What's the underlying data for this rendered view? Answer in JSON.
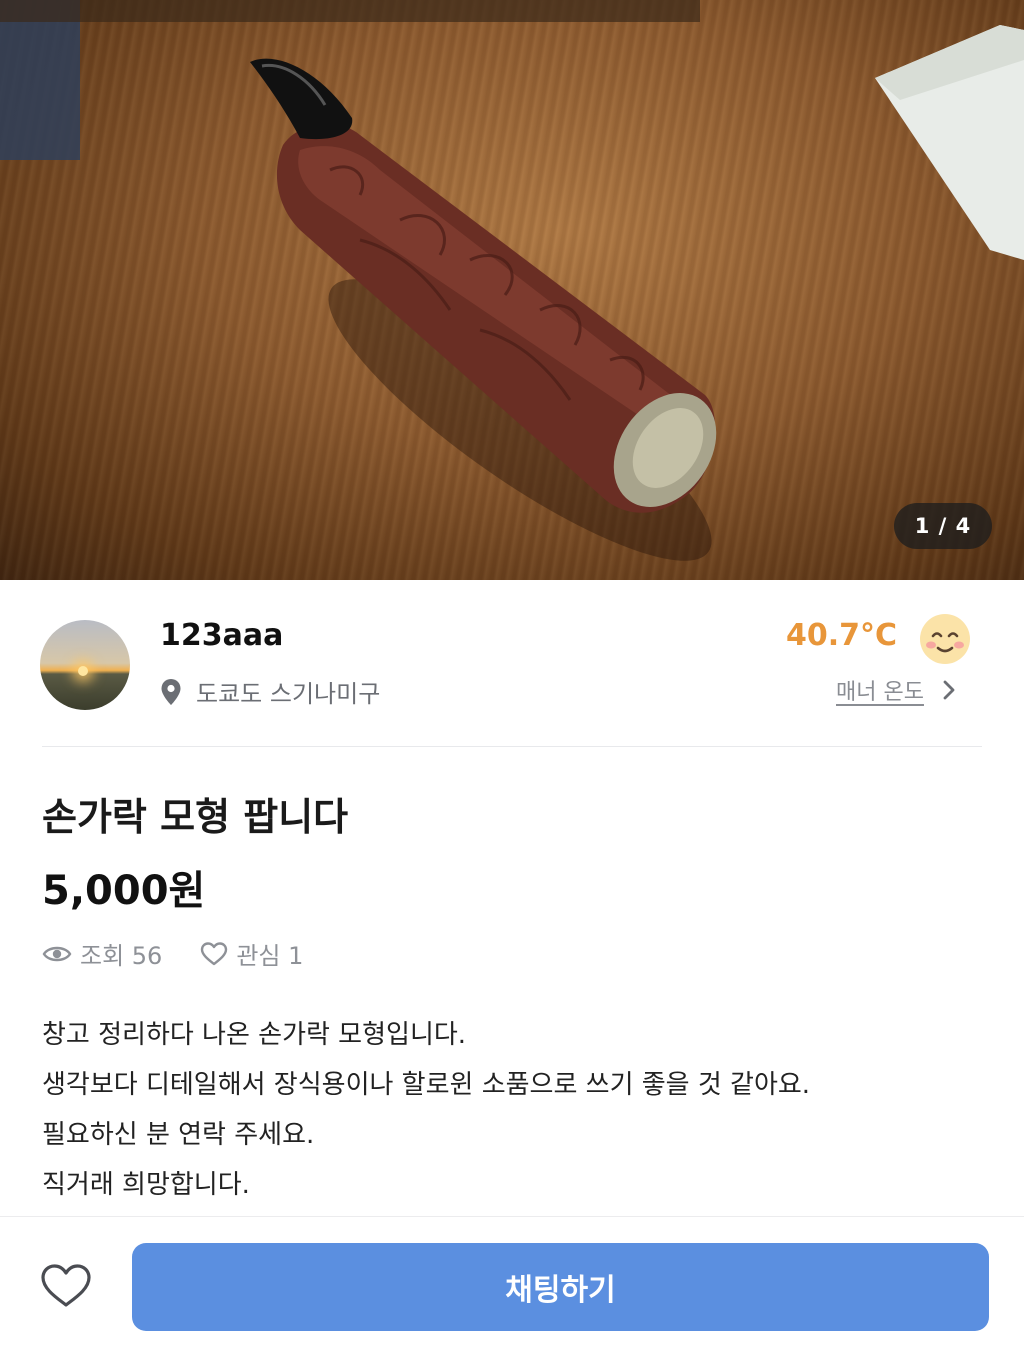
{
  "photo": {
    "subject": "brown finger model with black claw on wooden table",
    "counter": "1 / 4"
  },
  "seller": {
    "name": "123aaa",
    "location": "도쿄도 스기나미구",
    "temperature": "40.7°C",
    "manner_label": "매너 온도"
  },
  "item": {
    "title": "손가락 모형 팝니다",
    "price": "5,000원",
    "views_label": "조회 56",
    "likes_label": "관심 1",
    "description": [
      "창고 정리하다 나온 손가락 모형입니다.",
      "생각보다 디테일해서 장식용이나 할로윈 소품으로 쓰기 좋을 것 같아요.",
      "필요하신 분 연락 주세요.",
      "직거래 희망합니다."
    ]
  },
  "actions": {
    "chat_label": "채팅하기"
  },
  "icons": {
    "location": "location-pin-icon",
    "manner_face": "smiley-face-icon",
    "chevron": "chevron-right-icon",
    "views": "eye-icon",
    "likes": "heart-outline-icon",
    "like_button": "heart-outline-icon"
  },
  "colors": {
    "temperature": "#e8963a",
    "chat_button": "#5b8fe0",
    "muted_text": "#8e9197"
  }
}
